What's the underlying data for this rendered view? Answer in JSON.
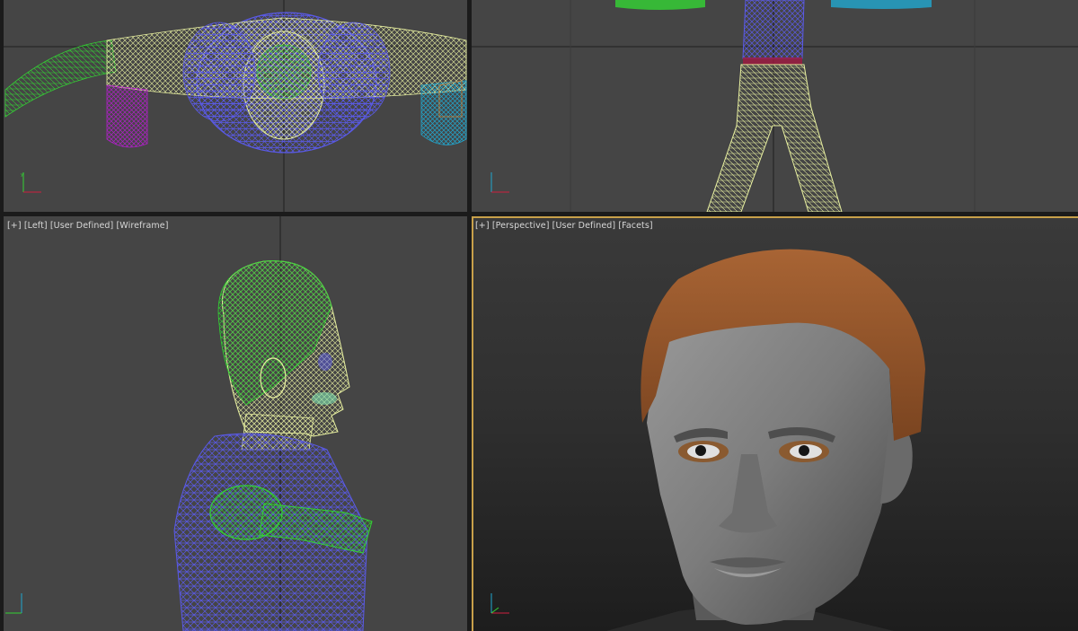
{
  "viewports": {
    "top": {
      "menu_plus": "",
      "view_name": "",
      "shading": "",
      "shading_mode": ""
    },
    "front": {
      "menu_plus": "",
      "view_name": "",
      "shading": "",
      "shading_mode": ""
    },
    "left": {
      "menu_plus": "[+]",
      "view_name": "[Left]",
      "shading": "[User Defined]",
      "shading_mode": "[Wireframe]"
    },
    "perspective": {
      "menu_plus": "[+]",
      "view_name": "[Perspective]",
      "shading": "[User Defined]",
      "shading_mode": "[Facets]"
    }
  },
  "colors": {
    "viewport_bg": "#454545",
    "grid_line": "#1e1e1e",
    "active_border": "#c8a04a",
    "wire_blue": "#5a5ae8",
    "wire_yellow": "#e8f0a0",
    "wire_green": "#33d433",
    "wire_magenta": "#b020c8",
    "wire_cyan": "#20a8d0",
    "wire_orange": "#d08030",
    "wire_red": "#d02040",
    "hair": "#9a5a2a",
    "skin": "#8a8a8a"
  }
}
